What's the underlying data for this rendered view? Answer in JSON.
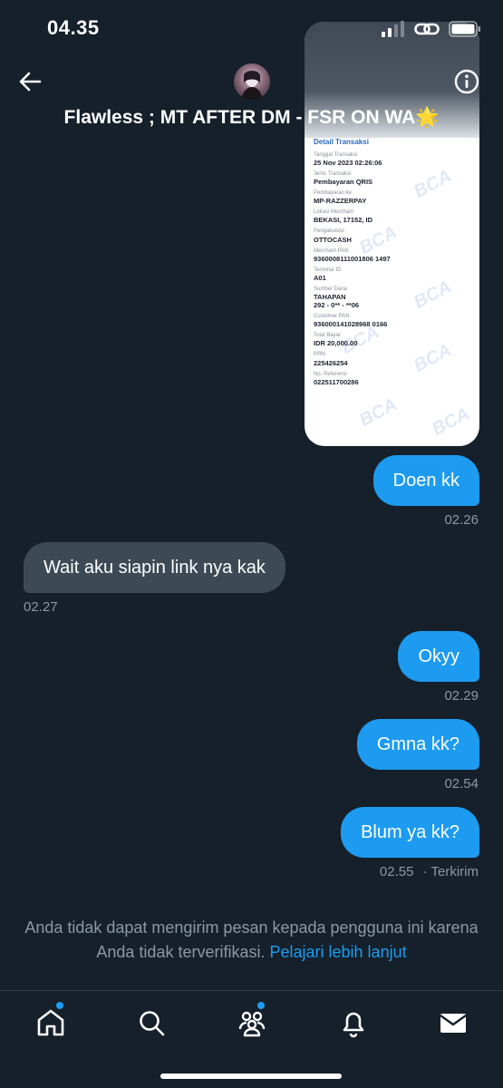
{
  "status_bar": {
    "time": "04.35"
  },
  "header": {
    "title": "Flawless ; MT AFTER DM - FSR ON WA🌟"
  },
  "receipt": {
    "heading": "Detail Transaksi",
    "watermark": "BCA",
    "fields": [
      {
        "label": "Tanggal Transaksi",
        "value": "25 Nov 2023 02:26:06"
      },
      {
        "label": "Jenis Transaksi",
        "value": "Pembayaran QRIS"
      },
      {
        "label": "Pembayaran ke",
        "value": "MP-RAZZERPAY"
      },
      {
        "label": "Lokasi Merchant",
        "value": "BEKASI, 17152, ID"
      },
      {
        "label": "Pengakuisisi",
        "value": "OTTOCASH"
      },
      {
        "label": "Merchant PAN",
        "value": "9360008111001806 1497"
      },
      {
        "label": "Terminal ID",
        "value": "A01"
      },
      {
        "label": "Sumber Dana",
        "value": "TAHAPAN\n292 - 0** - **06"
      },
      {
        "label": "Customer PAN",
        "value": "936000141028968 0166"
      },
      {
        "label": "Total Bayar",
        "value": "IDR 20,000.00"
      },
      {
        "label": "RRN",
        "value": "225426254"
      },
      {
        "label": "No. Referensi",
        "value": "022511700286"
      }
    ]
  },
  "messages": [
    {
      "direction": "out",
      "text": "Doen kk",
      "time": "02.26"
    },
    {
      "direction": "in",
      "text": "Wait aku siapin link nya kak",
      "time": "02.27"
    },
    {
      "direction": "out",
      "text": "Okyy",
      "time": "02.29"
    },
    {
      "direction": "out",
      "text": "Gmna kk?",
      "time": "02.54"
    },
    {
      "direction": "out",
      "text": "Blum ya kk?",
      "time": "02.55",
      "status": "· Terkirim"
    }
  ],
  "notice": {
    "text": "Anda tidak dapat mengirim pesan kepada pengguna ini karena Anda tidak terverifikasi.",
    "link": "Pelajari lebih lanjut"
  },
  "tabbar": {
    "items": [
      "home-icon",
      "search-icon",
      "communities-icon",
      "notifications-icon",
      "messages-icon"
    ]
  },
  "colors": {
    "background": "#15202b",
    "accent": "#1d9bf0",
    "incoming_bubble": "#3d4a56",
    "muted": "#8b98a5"
  }
}
